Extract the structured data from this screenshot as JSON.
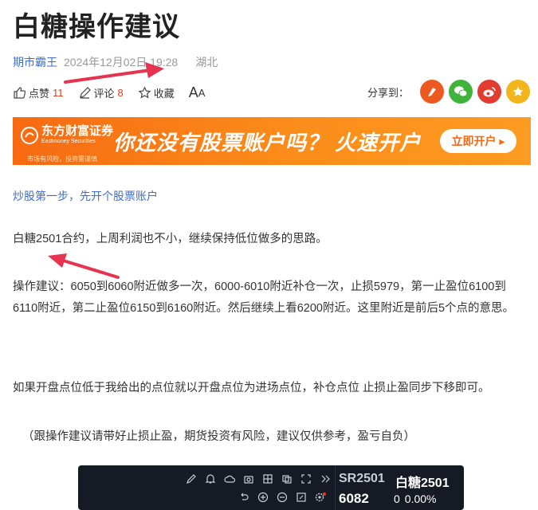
{
  "article": {
    "title": "白糖操作建议",
    "author": "期市霸王",
    "datetime": "2024年12月02日 19:28",
    "region": "湖北"
  },
  "actions": {
    "like_label": "点赞",
    "like_count": "11",
    "comment_label": "评论",
    "comment_count": "8",
    "favorite_label": "收藏",
    "font_big": "A",
    "font_small": "A",
    "share_label": "分享到："
  },
  "share_icons": [
    "flag-icon",
    "wechat-icon",
    "weibo-icon",
    "qzone-star-icon"
  ],
  "banner": {
    "brand_cn": "东方财富证券",
    "brand_en": "Eastmoney Securities",
    "risk_note": "市场有风险，投资需谨慎",
    "slogan": "你还没有股票账户吗？ 火速开户",
    "cta": "立即开户 ▸"
  },
  "body": {
    "open_account_link": "炒股第一步，先开个股票账户",
    "p1": "白糖2501合约，上周利润也不小，继续保持低位做多的思路。",
    "p2": "操作建议：6050到6060附近做多一次，6000-6010附近补仓一次，止损5979，第一止盈位6100到6110附近，第二止盈位6150到6160附近。然后继续上看6200附近。这里附近是前后5个点的意思。",
    "p3": "如果开盘点位低于我给出的点位就以开盘点位为进场点位，补仓点位 止损止盈同步下移即可。",
    "p4": "（跟操作建议请带好止损止盈，期货投资有风险，建议仅供参考，盈亏自负）"
  },
  "quote_widget": {
    "symbol": "SR2501",
    "name": "白糖2501",
    "price": "6082",
    "change": "0",
    "change_pct": "0.00%"
  },
  "colors": {
    "link_blue": "#3d6ec9",
    "count_red": "#e0401b",
    "banner_orange": "#f76a12",
    "annotation_arrow": "#e53350",
    "widget_bg": "#161a25"
  }
}
